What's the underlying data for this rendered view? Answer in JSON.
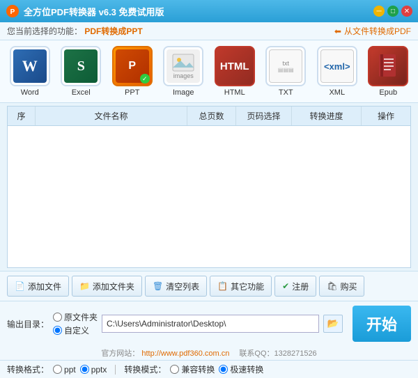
{
  "titleBar": {
    "title": "全方位PDF转换器 v6.3 免费试用版",
    "minLabel": "─",
    "maxLabel": "□",
    "closeLabel": "✕"
  },
  "topBar": {
    "currentLabel": "您当前选择的功能：",
    "currentValue": "PDF转换成PPT",
    "rightLink": "从文件转换成PDF"
  },
  "tools": [
    {
      "id": "word",
      "label": "Word",
      "type": "word"
    },
    {
      "id": "excel",
      "label": "Excel",
      "type": "excel"
    },
    {
      "id": "ppt",
      "label": "PPT",
      "type": "ppt",
      "active": true
    },
    {
      "id": "image",
      "label": "Image",
      "type": "image"
    },
    {
      "id": "html",
      "label": "HTML",
      "type": "html"
    },
    {
      "id": "txt",
      "label": "TXT",
      "type": "txt"
    },
    {
      "id": "xml",
      "label": "XML",
      "type": "xml"
    },
    {
      "id": "epub",
      "label": "Epub",
      "type": "epub"
    }
  ],
  "table": {
    "columns": [
      "序",
      "文件名称",
      "总页数",
      "页码选择",
      "转换进度",
      "操作"
    ]
  },
  "actions": [
    {
      "id": "add-file",
      "label": "添加文件",
      "icon": "📄"
    },
    {
      "id": "add-folder",
      "label": "添加文件夹",
      "icon": "📁"
    },
    {
      "id": "clear-list",
      "label": "清空列表",
      "icon": "🗑"
    },
    {
      "id": "other-func",
      "label": "其它功能",
      "icon": "📋"
    },
    {
      "id": "register",
      "label": "注册",
      "icon": "✔"
    },
    {
      "id": "buy",
      "label": "购买",
      "icon": "🛍"
    }
  ],
  "outputDir": {
    "label": "输出目录：",
    "options": [
      "原文件夹",
      "自定义"
    ],
    "path": "C:\\Users\\Administrator\\Desktop\\",
    "startBtn": "开始"
  },
  "websiteBar": {
    "text": "官方网站：",
    "url": "http://www.pdf360.com.cn",
    "separator": "　联系QQ：1328271526"
  },
  "bottomBar": {
    "formatLabel": "转换格式：",
    "formats": [
      "ppt",
      "pptx"
    ],
    "modeLabel": "转换模式：",
    "modes": [
      "兼容转换",
      "极速转换"
    ]
  }
}
